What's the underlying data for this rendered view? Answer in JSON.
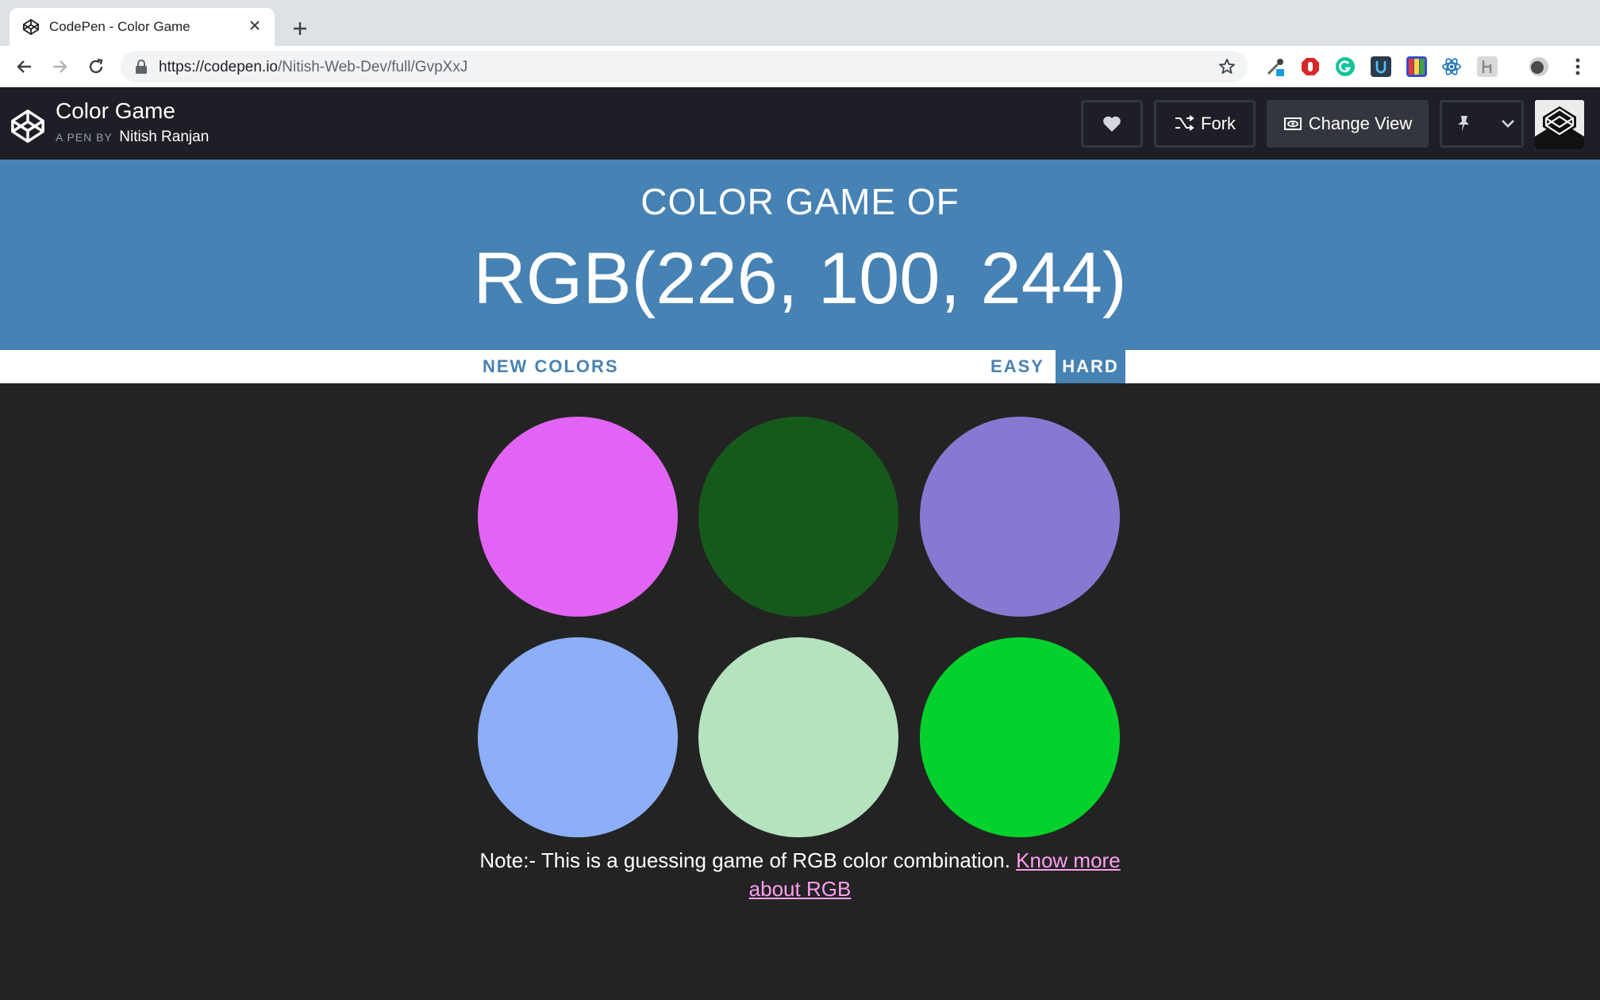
{
  "browser": {
    "tab_title": "CodePen - Color Game",
    "url_host": "https://codepen.io",
    "url_path": "/Nitish-Web-Dev/full/GvpXxJ"
  },
  "codepen": {
    "pen_title": "Color Game",
    "byline_prefix": "A PEN BY",
    "author": "Nitish Ranjan",
    "fork_label": "Fork",
    "change_view_label": "Change View"
  },
  "game": {
    "title_line": "COLOR GAME OF",
    "target_color": "RGB(226, 100, 244)",
    "new_colors_label": "NEW COLORS",
    "easy_label": "EASY",
    "hard_label": "HARD",
    "active_mode": "HARD",
    "squares": [
      {
        "color": "#e264f4"
      },
      {
        "color": "#155a1b"
      },
      {
        "color": "#8679d1"
      },
      {
        "color": "#8daff7"
      },
      {
        "color": "#b5e3be"
      },
      {
        "color": "#04d12b"
      }
    ],
    "note_text": "Note:- This is a guessing game of RGB color combination.",
    "note_link": "Know more about RGB"
  },
  "colors": {
    "header_bg": "#4682b4",
    "body_bg": "#232323",
    "codepen_bar": "#1e1f26",
    "link_pink": "#ff9ff3"
  },
  "icons": [
    "codepen-logo-icon",
    "close-icon",
    "plus-icon",
    "back-arrow-icon",
    "forward-arrow-icon",
    "reload-icon",
    "lock-icon",
    "star-icon",
    "heart-icon",
    "fork-icon",
    "eye-icon",
    "pin-icon",
    "chevron-down-icon",
    "kebab-menu-icon"
  ]
}
